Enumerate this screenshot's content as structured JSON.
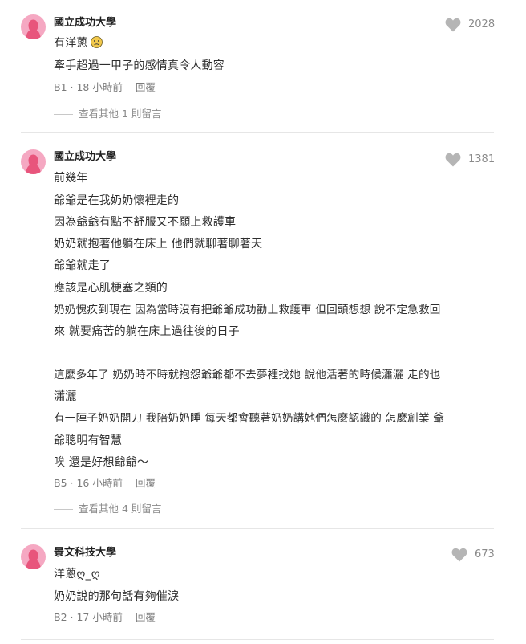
{
  "comments": [
    {
      "school": "國立成功大學",
      "likes": "2028",
      "lines": [
        "有洋蔥",
        "牽手超過一甲子的感情真令人動容"
      ],
      "meta": "B1 · 18 小時前",
      "reply_label": "回覆",
      "more_replies": "查看其他 1 則留言"
    },
    {
      "school": "國立成功大學",
      "likes": "1381",
      "lines": [
        "前幾年",
        "爺爺是在我奶奶懷裡走的",
        "因為爺爺有點不舒服又不願上救護車",
        "奶奶就抱著他躺在床上 他們就聊著聊著天",
        "爺爺就走了",
        "應該是心肌梗塞之類的",
        "奶奶愧疚到現在 因為當時沒有把爺爺成功勸上救護車 但回頭想想 說不定急救回",
        "來 就要痛苦的躺在床上過往後的日子",
        "這麼多年了 奶奶時不時就抱怨爺爺都不去夢裡找她 說他活著的時候瀟灑 走的也",
        "瀟灑",
        "有一陣子奶奶開刀 我陪奶奶睡 每天都會聽著奶奶講她們怎麼認識的 怎麼創業 爺",
        "爺聰明有智慧",
        "唉 還是好想爺爺～"
      ],
      "meta": "B5 · 16 小時前",
      "reply_label": "回覆",
      "more_replies": "查看其他 4 則留言"
    },
    {
      "school": "景文科技大學",
      "likes": "673",
      "lines": [
        "洋蔥ღ_ღ",
        "奶奶說的那句話有夠催淚"
      ],
      "meta": "B2 · 17 小時前",
      "reply_label": "回覆"
    }
  ],
  "icons": {
    "avatar": "female-avatar-icon",
    "like": "heart-icon",
    "emoji": "sad-face-emoji-icon"
  },
  "colors": {
    "avatar_bg": "#f5a8c2",
    "avatar_figure": "#e8557c",
    "heart": "#b5b5b5",
    "emoji": "#f2c94c"
  }
}
